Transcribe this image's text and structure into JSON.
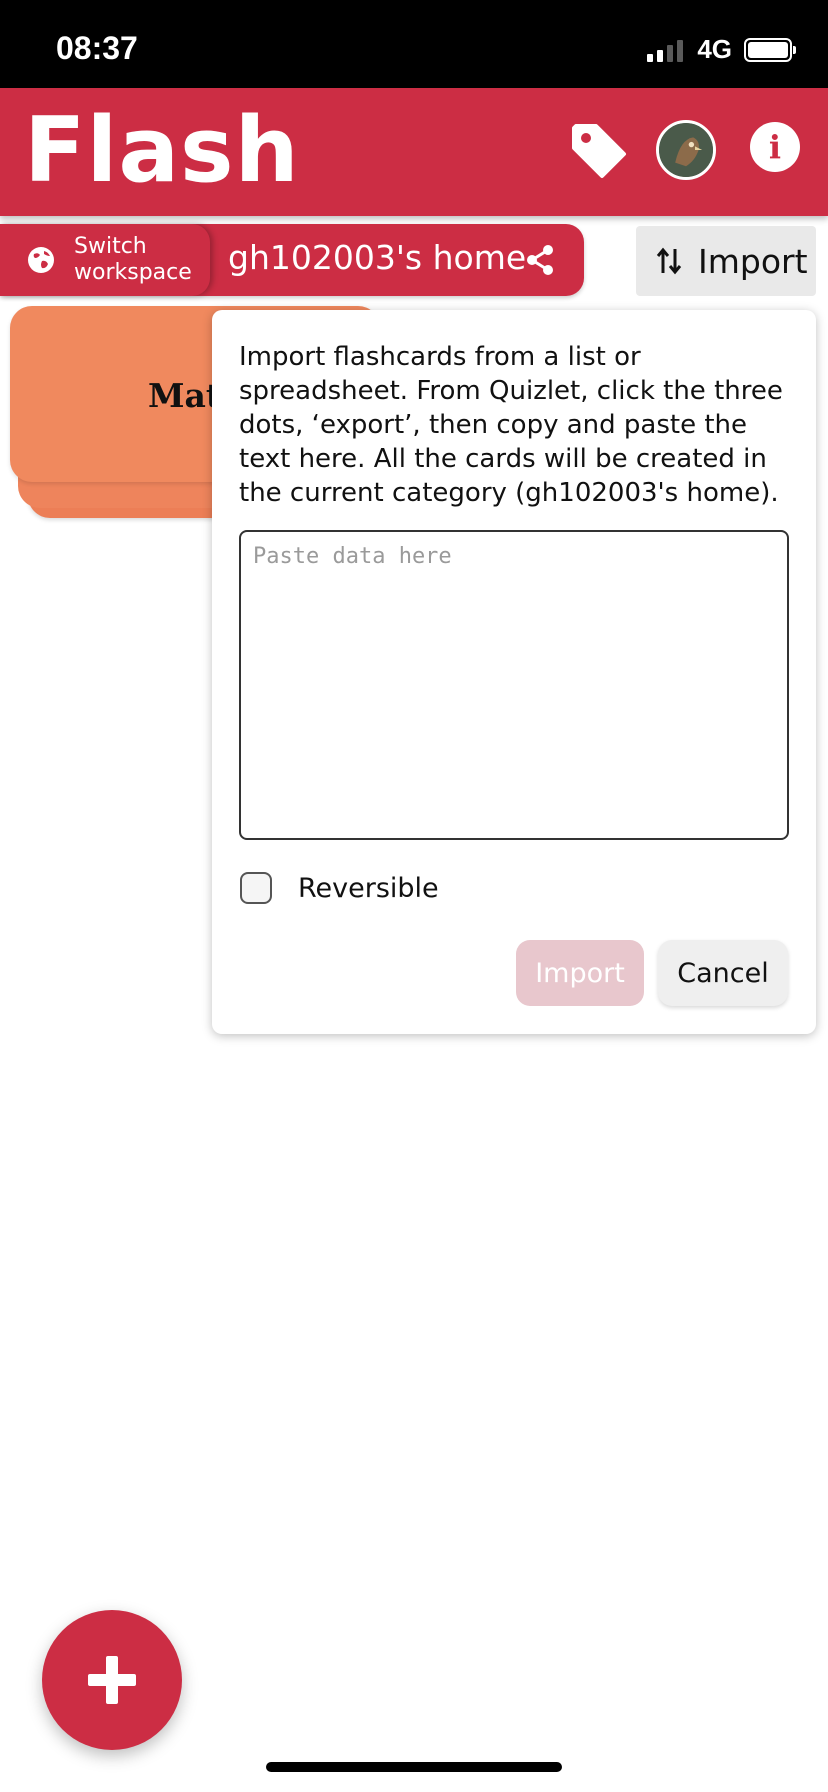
{
  "status_bar": {
    "time": "08:37",
    "network": "4G",
    "icons": [
      "signal-icon",
      "battery-icon"
    ]
  },
  "header": {
    "title": "Flash",
    "icons": [
      "tag-icon",
      "avatar",
      "info-icon"
    ],
    "info_glyph": "i"
  },
  "toolbar": {
    "switch_label": "Switch\nworkspace",
    "workspace_name": "gh102003's home",
    "import_label": "Import",
    "icons": [
      "globe-icon",
      "share-icon",
      "swap-arrows-icon"
    ]
  },
  "card": {
    "title": "Mat"
  },
  "dialog": {
    "description": "Import flashcards from a list or spreadsheet. From Quizlet, click the three dots, ‘export’, then copy and paste the text here. All the cards will be created in the current category (gh102003's home).",
    "placeholder": "Paste data here",
    "reversible_label": "Reversible",
    "import_label": "Import",
    "cancel_label": "Cancel"
  },
  "fab": {
    "icon": "plus-icon"
  },
  "colors": {
    "brand": "#cc2d44",
    "card": "#f0895e",
    "disabled_button": "#e8c7cd"
  }
}
